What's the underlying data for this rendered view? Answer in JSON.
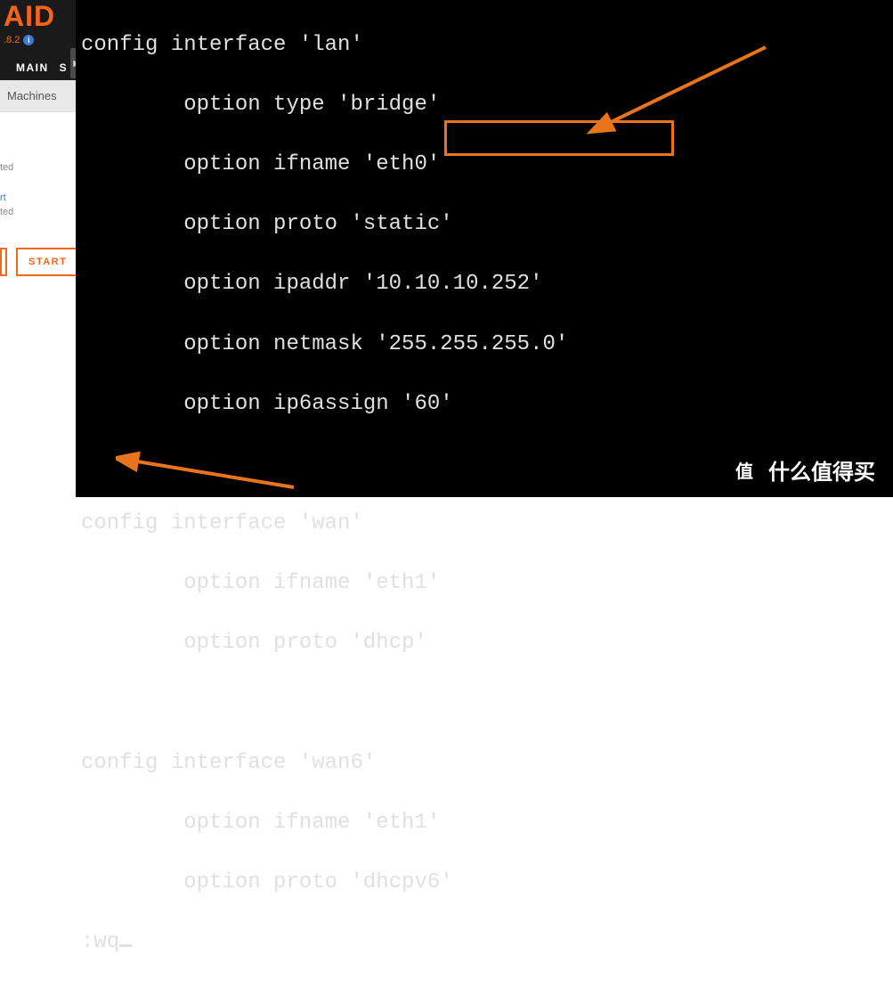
{
  "sidebar": {
    "logo": "AID",
    "version": ".8.2",
    "nav": {
      "main": "MAIN",
      "s": "S"
    },
    "section_header": "Machines",
    "items": [
      {
        "status": "ted"
      },
      {
        "name": "rt",
        "status": "ted"
      }
    ],
    "start_btn": "START"
  },
  "terminal": {
    "lines": [
      "config interface 'lan'",
      "        option type 'bridge'",
      "        option ifname 'eth0'",
      "        option proto 'static'",
      "        option ipaddr '10.10.10.252'",
      "        option netmask '255.255.255.0'",
      "        option ip6assign '60'",
      "",
      "config interface 'wan'",
      "        option ifname 'eth1'",
      "        option proto 'dhcp'",
      "",
      "config interface 'wan6'",
      "        option ifname 'eth1'",
      "        option proto 'dhcpv6'"
    ],
    "command": ":wq"
  },
  "annotation": {
    "highlighted_value": "'10.10.10.252'",
    "highlight_color": "#e8741c"
  },
  "watermark": {
    "circle": "值",
    "text": "什么值得买"
  }
}
